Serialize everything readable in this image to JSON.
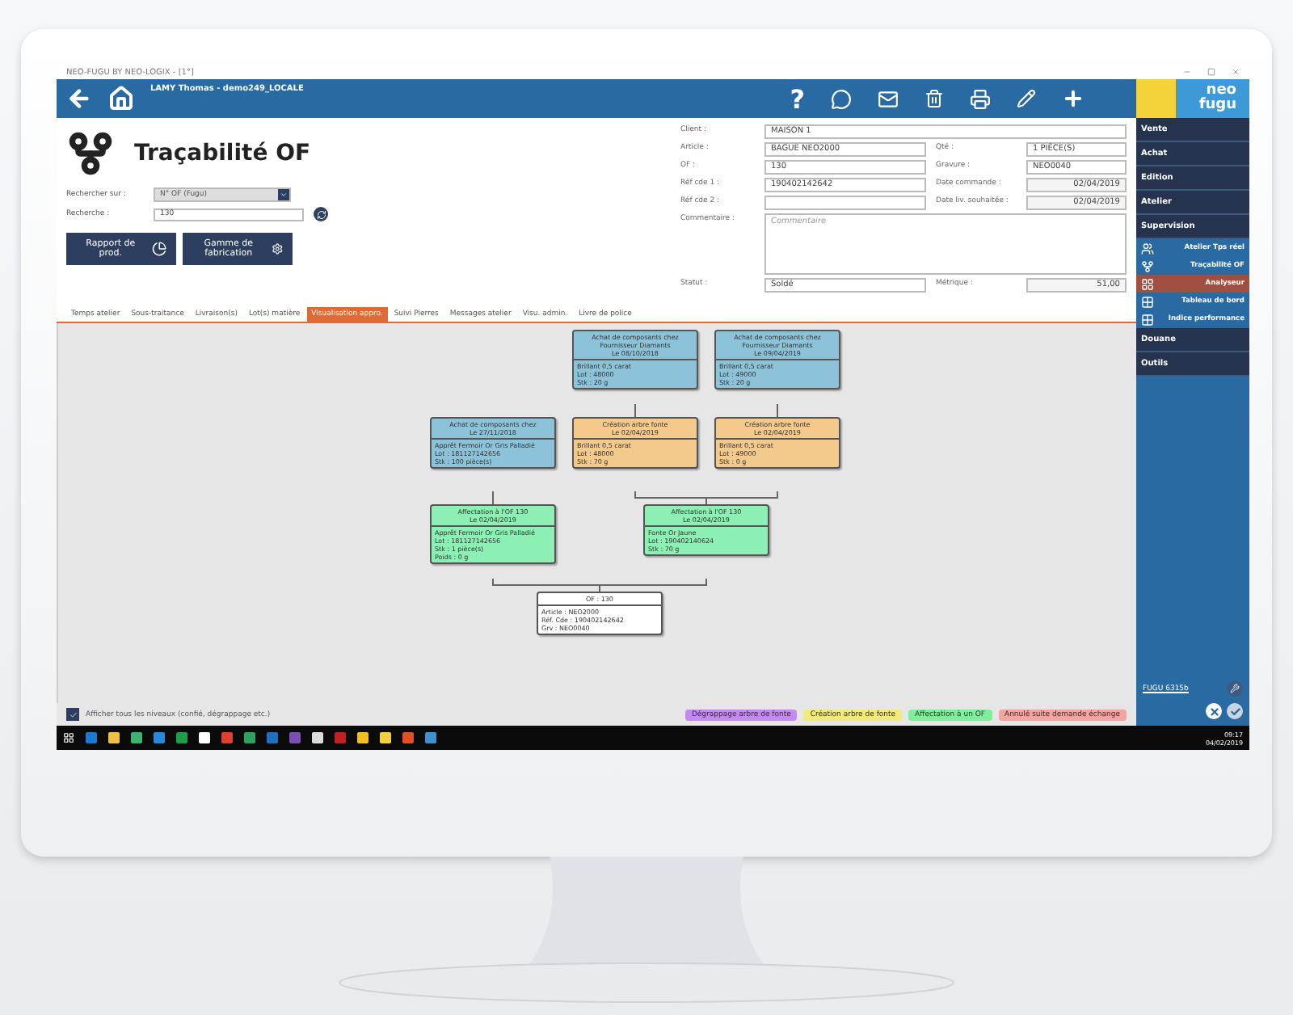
{
  "window": {
    "title": "NEO-FUGU BY NEO-LOGIX - [1°]"
  },
  "header": {
    "user": "LAMY Thomas  -  demo249_LOCALE",
    "help_glyph": "?"
  },
  "logo": {
    "line1": "neo",
    "line2": "fugu"
  },
  "page": {
    "title": "Traçabilité OF"
  },
  "search": {
    "by_label": "Rechercher sur :",
    "by_value": "N° OF (Fugu)",
    "query_label": "Recherche :",
    "query_value": "130"
  },
  "action_buttons": [
    {
      "label": "Rapport de prod.",
      "kind": "report"
    },
    {
      "label": "Gamme de fabrication",
      "kind": "routing"
    }
  ],
  "form": [
    [
      {
        "label": "Client :",
        "value": "MAISON 1",
        "kind": "input"
      }
    ],
    [
      {
        "label": "Article :",
        "value": "BAGUE NEO2000",
        "kind": "input"
      },
      {
        "label": "Qté :",
        "value": "1 PIÈCE(S)",
        "kind": "input"
      }
    ],
    [
      {
        "label": "OF :",
        "value": "130",
        "kind": "input"
      },
      {
        "label": "Gravure :",
        "value": "NEO0040",
        "kind": "input"
      }
    ],
    [
      {
        "label": "Réf cde 1 :",
        "value": "190402142642",
        "kind": "input"
      },
      {
        "label": "Date commande :",
        "value": "02/04/2019",
        "kind": "date"
      }
    ],
    [
      {
        "label": "Réf cde 2 :",
        "kind": "input"
      },
      {
        "label": "Date liv. souhaitée :",
        "value": "02/04/2019",
        "kind": "date"
      }
    ],
    [
      {
        "label": "Commentaire :",
        "placeholder": "Commentaire",
        "kind": "textarea"
      }
    ],
    [
      {
        "label": "Statut :",
        "value": "Soldé",
        "kind": "input"
      },
      {
        "label": "Métrique :",
        "value": "51,00",
        "kind": "date"
      }
    ]
  ],
  "tabs": [
    {
      "label": "Temps atelier",
      "selected": false
    },
    {
      "label": "Sous-traitance",
      "selected": false
    },
    {
      "label": "Livraison(s)",
      "selected": false
    },
    {
      "label": "Lot(s) matière",
      "selected": false
    },
    {
      "label": "Visualisation appro.",
      "selected": true
    },
    {
      "label": "Suivi Pierres",
      "selected": false
    },
    {
      "label": "Messages atelier",
      "selected": false
    },
    {
      "label": "Visu. admin.",
      "selected": false
    },
    {
      "label": "Livre de police",
      "selected": false
    }
  ],
  "diagram": {
    "nodes": [
      {
        "kind": "supply",
        "title": [
          "Achat de composants chez",
          "Fournisseur Diamants",
          "Le 08/10/2018"
        ],
        "lines": [
          "Brillant 0,5 carat",
          "Lot : 48000",
          "Stk : 20 g"
        ]
      },
      {
        "kind": "supply",
        "title": [
          "Achat de composants chez",
          "Fournisseur Diamants",
          "Le 09/04/2019"
        ],
        "lines": [
          "Brillant 0,5 carat",
          "Lot : 49000",
          "Stk : 20 g"
        ]
      },
      {
        "kind": "supply",
        "title": [
          "Achat de composants chez",
          "Le 27/11/2018"
        ],
        "lines": [
          "Apprêt Fermoir Or Gris Palladié",
          "Lot : 181127142656",
          "Stk : 100 pièce(s)"
        ]
      },
      {
        "kind": "creation",
        "title": [
          "Création arbre fonte",
          "Le 02/04/2019"
        ],
        "lines": [
          "Brillant 0,5 carat",
          "Lot : 48000",
          "Stk : 70 g"
        ]
      },
      {
        "kind": "creation",
        "title": [
          "Création arbre fonte",
          "Le 02/04/2019"
        ],
        "lines": [
          "Brillant 0,5 carat",
          "Lot : 49000",
          "Stk : 0 g"
        ]
      },
      {
        "kind": "assignment",
        "title": [
          "Affectation à l'OF 130",
          "Le 02/04/2019"
        ],
        "lines": [
          "Apprêt Fermoir Or Gris Palladié",
          "Lot : 181127142656",
          "Stk : 1 pièce(s)",
          "Poids : 0 g"
        ]
      },
      {
        "kind": "assignment",
        "title": [
          "Affectation à l'OF 130",
          "Le 02/04/2019"
        ],
        "lines": [
          "Fonte Or Jaune",
          "Lot : 190402140624",
          "Stk : 70 g"
        ]
      },
      {
        "kind": "result",
        "title": [
          "OF : 130"
        ],
        "lines": [
          "Article : NEO2000",
          "Réf. Cde : 190402142642",
          "Grv : NEO0040"
        ]
      }
    ]
  },
  "show_all": {
    "label": "Afficher tous les niveaux (confié, dégrappage etc.)",
    "checked": true
  },
  "legend": [
    {
      "label": "Dégrappage arbre de fonte",
      "color": "#c58af0"
    },
    {
      "label": "Création arbre de fonte",
      "color": "#f2ea7c"
    },
    {
      "label": "Affectation à un OF",
      "color": "#80ef9c"
    },
    {
      "label": "Annulé suite demande échange",
      "color": "#f3a3a0"
    }
  ],
  "menu": [
    {
      "label": "Vente",
      "kind": "section",
      "selected": false
    },
    {
      "label": "Achat",
      "kind": "section",
      "selected": false
    },
    {
      "label": "Edition",
      "kind": "section",
      "selected": false
    },
    {
      "label": "Atelier",
      "kind": "section",
      "selected": false
    },
    {
      "label": "Supervision",
      "kind": "section",
      "selected": false
    },
    {
      "label": "Atelier Tps réel",
      "kind": "item",
      "selected": false
    },
    {
      "label": "Traçabilité OF",
      "kind": "item",
      "selected": false
    },
    {
      "label": "Analyseur",
      "kind": "item",
      "selected": true
    },
    {
      "label": "Tableau de bord",
      "kind": "item",
      "selected": false
    },
    {
      "label": "Indice performance",
      "kind": "item",
      "selected": false
    },
    {
      "label": "Douane",
      "kind": "section",
      "selected": false
    },
    {
      "label": "Outils",
      "kind": "section",
      "selected": false
    }
  ],
  "sidebar_footer": {
    "version": "FUGU 6315b"
  },
  "taskbar": {
    "time": "09:17",
    "date": "04/02/2019"
  }
}
